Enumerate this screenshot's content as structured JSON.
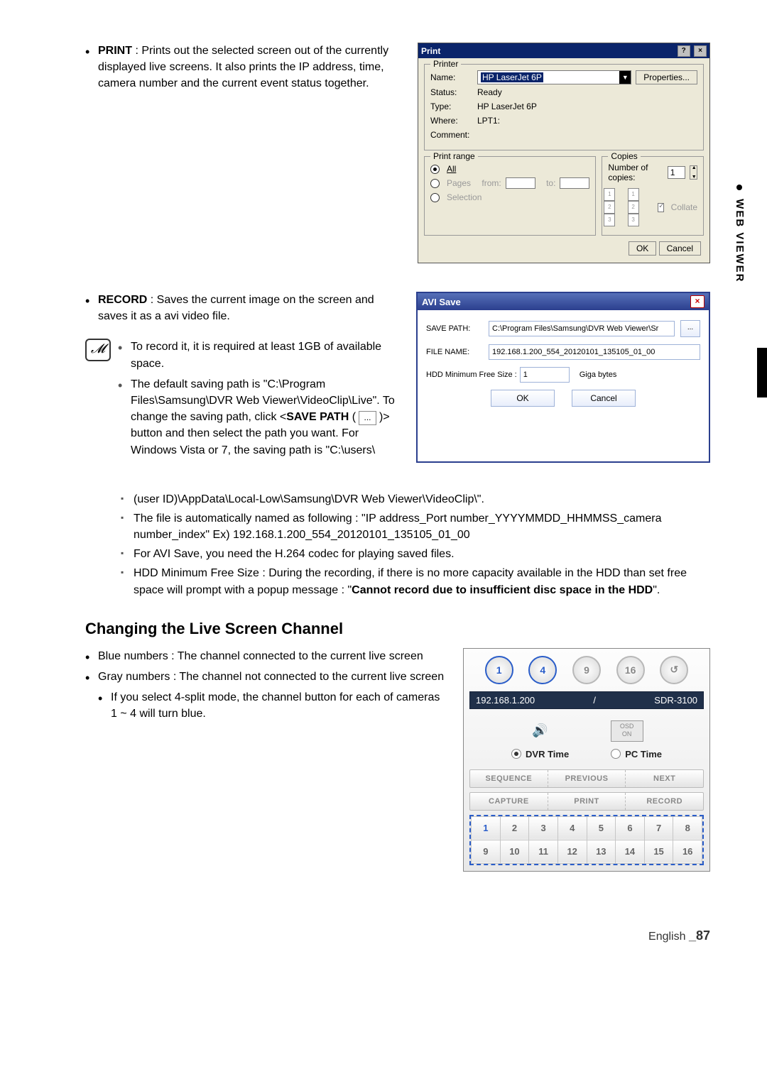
{
  "side_tab": {
    "label": "WEB VIEWER"
  },
  "print_section": {
    "term": "PRINT",
    "desc": " : Prints out the selected screen out of the currently displayed live screens. It also prints the IP address, time, camera number and the current event status together."
  },
  "print_dialog": {
    "title": "Print",
    "help": "?",
    "close": "×",
    "printer_legend": "Printer",
    "name_lbl": "Name:",
    "name_val": "HP LaserJet 6P",
    "properties_btn": "Properties...",
    "status_lbl": "Status:",
    "status_val": "Ready",
    "type_lbl": "Type:",
    "type_val": "HP LaserJet 6P",
    "where_lbl": "Where:",
    "where_val": "LPT1:",
    "comment_lbl": "Comment:",
    "range_legend": "Print range",
    "all_lbl": "All",
    "pages_lbl": "Pages",
    "from_lbl": "from:",
    "to_lbl": "to:",
    "selection_lbl": "Selection",
    "copies_legend": "Copies",
    "num_copies_lbl": "Number of copies:",
    "num_copies_val": "1",
    "collate_lbl": "Collate",
    "ok_btn": "OK",
    "cancel_btn": "Cancel"
  },
  "record_section": {
    "term": "RECORD",
    "desc": " : Saves the current image on the screen and saves it as a avi video file.",
    "notes": [
      "To record it, it is required at least 1GB of available space.",
      "The default saving path is \"C:\\Program Files\\Samsung\\DVR Web Viewer\\VideoClip\\Live\". To change the saving path, click <SAVE PATH ( ... )> button and then select the path you want. For Windows Vista or 7, the saving path is \"C:\\users\\(user ID)\\AppData\\Local-Low\\Samsung\\DVR Web Viewer\\VideoClip\\\".",
      "The file is automatically named as following : \"IP address_Port number_YYYYMMDD_HHMMSS_camera number_index\" Ex) 192.168.1.200_554_20120101_135105_01_00",
      "For AVI Save, you need the H.264 codec for playing saved files.",
      "HDD Minimum Free Size : During the recording, if there is no more capacity available in the HDD than set free space will prompt with a popup message : \"Cannot record due to insufficient disc space in the HDD\"."
    ],
    "save_path_token": "SAVE PATH",
    "cannot_record_msg": "Cannot record due to insufficient disc space in the HDD"
  },
  "avi_dialog": {
    "title": "AVI Save",
    "save_path_lbl": "SAVE PATH:",
    "save_path_val": "C:\\Program Files\\Samsung\\DVR Web Viewer\\Sr",
    "file_name_lbl": "FILE NAME:",
    "file_name_val": "192.168.1.200_554_20120101_135105_01_00",
    "hdd_lbl": "HDD Minimum Free Size :",
    "hdd_val": "1",
    "giga": "Giga bytes",
    "browse": "...",
    "ok": "OK",
    "cancel": "Cancel"
  },
  "live_heading": "Changing the Live Screen Channel",
  "live_bullets": {
    "blue": "Blue numbers : The channel connected to the current live screen",
    "gray": "Gray numbers : The channel not connected to the current live screen",
    "split": "If you select 4-split mode, the channel button for each of cameras 1 ~ 4 will turn blue."
  },
  "live_panel": {
    "modes": [
      "1",
      "4",
      "9",
      "16",
      "↺"
    ],
    "ip": "192.168.1.200",
    "sep": "/",
    "model": "SDR-3100",
    "osd": "OSD\nON",
    "dvr_time": "DVR Time",
    "pc_time": "PC Time",
    "bar1": [
      "SEQUENCE",
      "PREVIOUS",
      "NEXT"
    ],
    "bar2": [
      "CAPTURE",
      "PRINT",
      "RECORD"
    ],
    "channels_row1": [
      "1",
      "2",
      "3",
      "4",
      "5",
      "6",
      "7",
      "8"
    ],
    "channels_row2": [
      "9",
      "10",
      "11",
      "12",
      "13",
      "14",
      "15",
      "16"
    ]
  },
  "footer": {
    "lang": "English ",
    "page": "_87"
  }
}
